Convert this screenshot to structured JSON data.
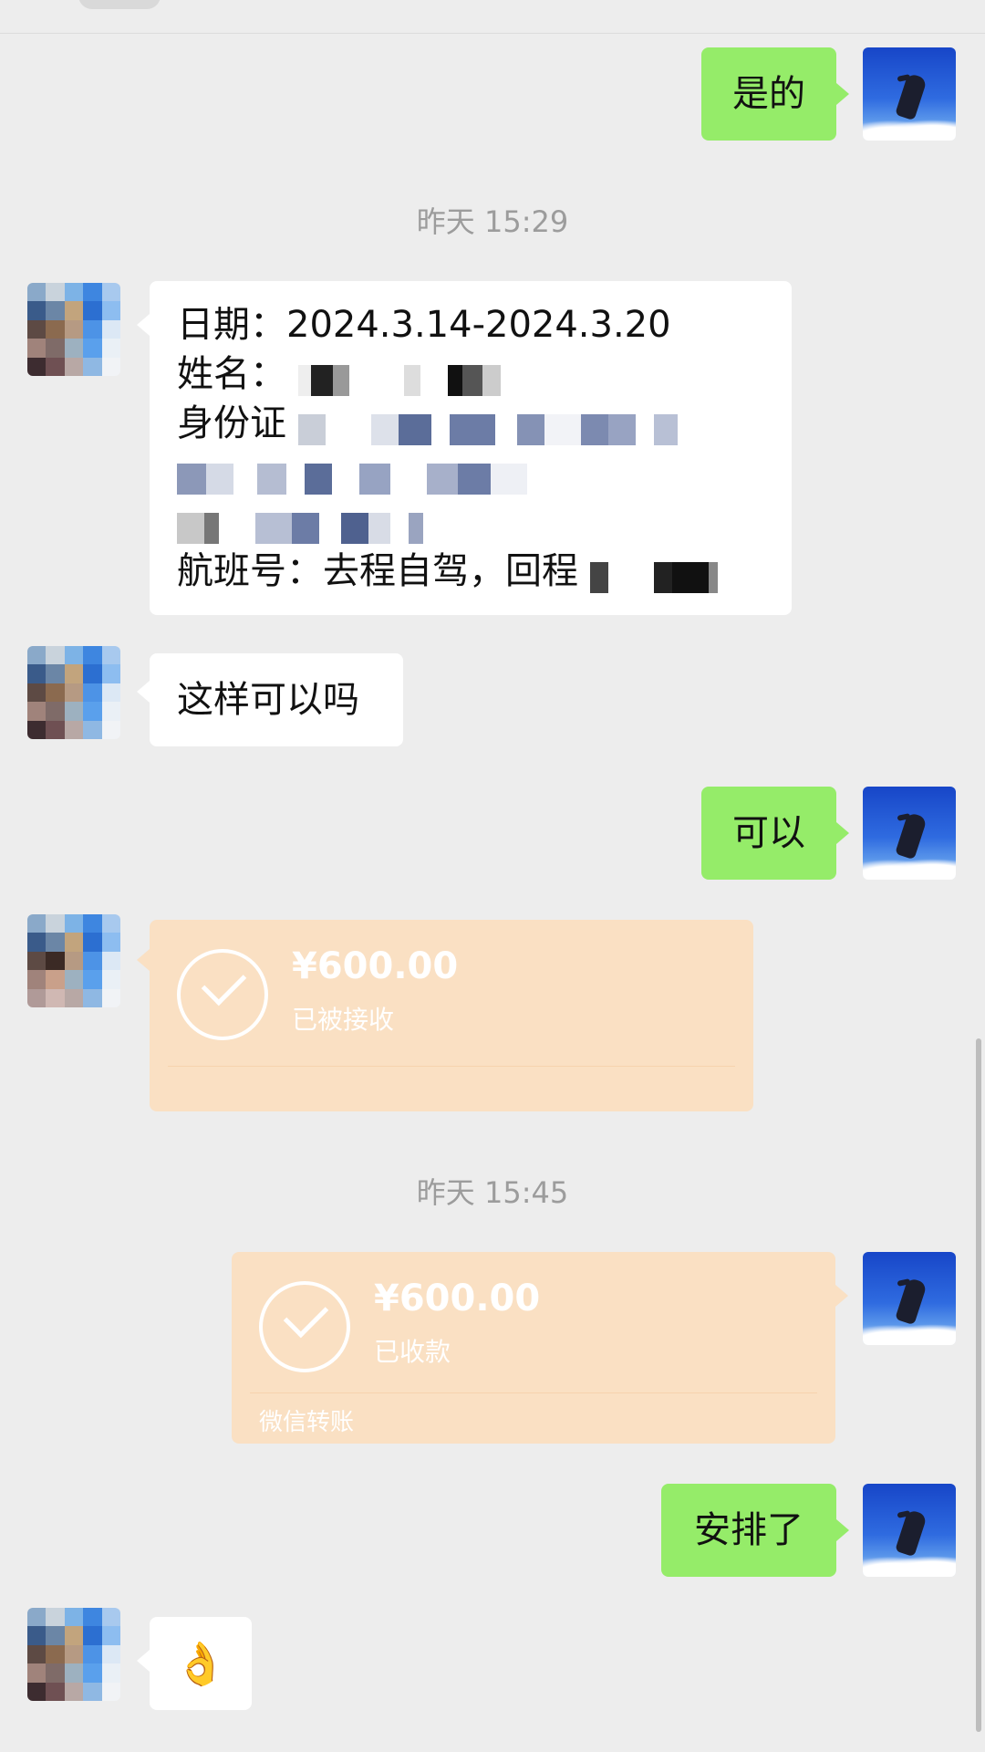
{
  "messages": {
    "m1": "是的",
    "time1": "昨天 15:29",
    "info_date_label": "日期：",
    "info_date_value": "2024.3.14-2024.3.20",
    "info_name_label": "姓名：",
    "info_id_label": "身份证",
    "info_flight_label": "航班号：去程自驾，回程",
    "m2": "这样可以吗",
    "m3": "可以",
    "time2": "昨天 15:45",
    "m4": "安排了",
    "m5_emoji": "👌"
  },
  "transfer_received": {
    "amount": "¥600.00",
    "status": "已被接收"
  },
  "transfer_collected": {
    "amount": "¥600.00",
    "status": "已收款",
    "footer": "微信转账"
  },
  "colors": {
    "background": "#ededed",
    "my_bubble": "#95ec69",
    "their_bubble": "#ffffff",
    "transfer_card": "#fae0c3",
    "timestamp": "#9c9c9c"
  },
  "icons": {
    "transfer_check": "check-circle-icon",
    "my_avatar": "avatar-image",
    "their_avatar": "pixelated-avatar-image"
  }
}
